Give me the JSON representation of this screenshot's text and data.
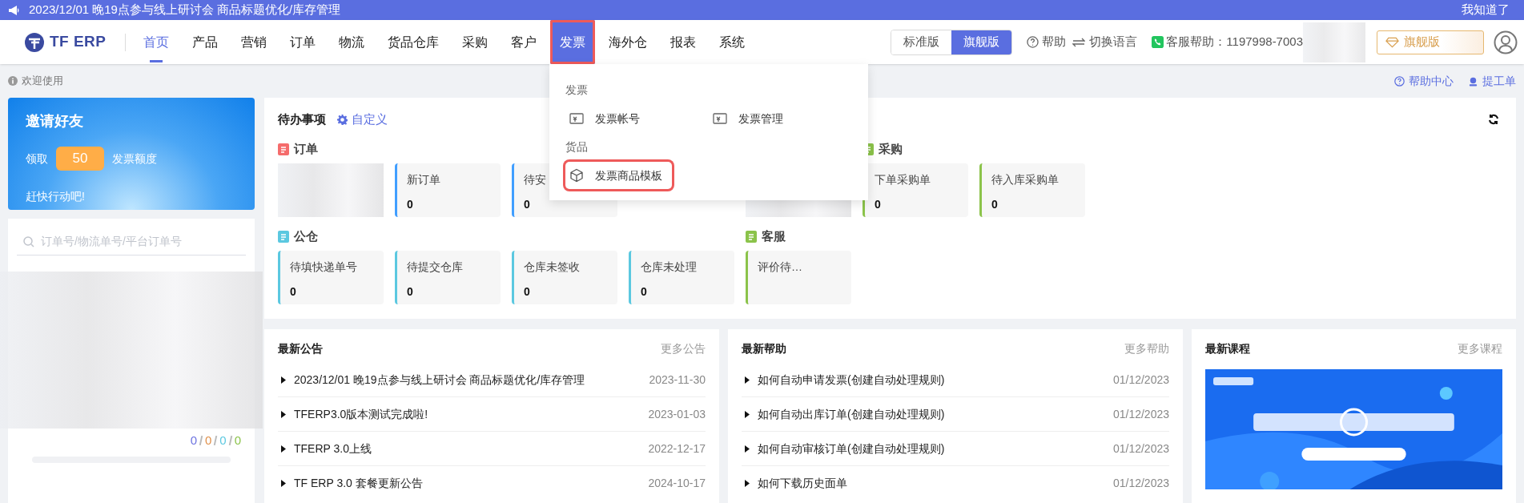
{
  "banner": {
    "text": "2023/12/01 晚19点参与线上研讨会 商品标题优化/库存管理",
    "dismiss": "我知道了"
  },
  "header": {
    "logo": "TF ERP",
    "nav": [
      {
        "label": "首页",
        "selected": true,
        "open": false,
        "annotated": false
      },
      {
        "label": "产品",
        "selected": false,
        "open": false,
        "annotated": false
      },
      {
        "label": "营销",
        "selected": false,
        "open": false,
        "annotated": false
      },
      {
        "label": "订单",
        "selected": false,
        "open": false,
        "annotated": false
      },
      {
        "label": "物流",
        "selected": false,
        "open": false,
        "annotated": false
      },
      {
        "label": "货品仓库",
        "selected": false,
        "open": false,
        "annotated": false
      },
      {
        "label": "采购",
        "selected": false,
        "open": false,
        "annotated": false
      },
      {
        "label": "客户",
        "selected": false,
        "open": false,
        "annotated": false
      },
      {
        "label": "发票",
        "selected": false,
        "open": true,
        "annotated": true
      },
      {
        "label": "海外仓",
        "selected": false,
        "open": false,
        "annotated": false
      },
      {
        "label": "报表",
        "selected": false,
        "open": false,
        "annotated": false
      },
      {
        "label": "系统",
        "selected": false,
        "open": false,
        "annotated": false
      }
    ],
    "editions": [
      {
        "label": "标准版",
        "selected": false
      },
      {
        "label": "旗舰版",
        "selected": true
      }
    ],
    "help": "帮助",
    "language": "切换语言",
    "support": "客服帮助：1197998-7003",
    "upgrade": "旗舰版"
  },
  "dropdown": {
    "groups": [
      {
        "title": "发票",
        "items": [
          {
            "label": "发票帐号",
            "kind": "invoice",
            "annotated": false
          },
          {
            "label": "发票管理",
            "kind": "invoice",
            "annotated": false
          }
        ]
      },
      {
        "title": "货品",
        "items": [
          {
            "label": "发票商品模板",
            "kind": "box",
            "annotated": true
          }
        ]
      }
    ]
  },
  "welcome": {
    "text": "欢迎使用",
    "links": [
      {
        "label": "帮助中心",
        "kind": "help"
      },
      {
        "label": "提工单",
        "kind": "ticket"
      }
    ]
  },
  "invite": {
    "title": "邀请好友",
    "prefix": "领取",
    "amount": "50",
    "suffix": "发票额度",
    "cta": "赶快行动吧!"
  },
  "sidebar": {
    "search": {
      "placeholder": "订单号/物流单号/平台订单号"
    },
    "counts": [
      {
        "value": "0",
        "color": "#6c72e0"
      },
      {
        "value": "0",
        "color": "#e0904a"
      },
      {
        "value": "0",
        "color": "#5bc8e0"
      },
      {
        "value": "0",
        "color": "#8bc34a"
      }
    ]
  },
  "todo": {
    "title": "待办事项",
    "customize": "自定义",
    "rows": [
      {
        "sections": [
          {
            "label": "订单",
            "color": "#f56c6c",
            "cards": [
              {
                "kind": "blurred"
              },
              {
                "kind": "card",
                "label": "新订单",
                "value": "0",
                "color": "#409eff"
              },
              {
                "kind": "card",
                "label": "待安",
                "value": "0",
                "color": "#409eff"
              },
              {
                "kind": "hidden"
              },
              {
                "kind": "blurred"
              }
            ]
          },
          {
            "label": "采购",
            "color": "#8bc34a",
            "cards": [
              {
                "kind": "card",
                "label": "下单采购单",
                "value": "0",
                "color": "#8bc34a"
              },
              {
                "kind": "card",
                "label": "待入库采购单",
                "value": "0",
                "color": "#8bc34a"
              }
            ]
          }
        ]
      },
      {
        "sections": [
          {
            "label": "公仓",
            "color": "#5bc8e0",
            "cards": [
              {
                "kind": "card",
                "label": "待填快递单号",
                "value": "0",
                "color": "#5bc8e0"
              },
              {
                "kind": "card",
                "label": "待提交仓库",
                "value": "0",
                "color": "#5bc8e0"
              },
              {
                "kind": "card",
                "label": "仓库未签收",
                "value": "0",
                "color": "#5bc8e0"
              },
              {
                "kind": "card",
                "label": "仓库未处理",
                "value": "0",
                "color": "#5bc8e0"
              }
            ]
          },
          {
            "label": "客服",
            "color": "#8bc34a",
            "cards": [
              {
                "kind": "card",
                "label": "评价待…",
                "color": "#8bc34a"
              }
            ]
          }
        ]
      }
    ]
  },
  "panels": [
    {
      "title": "最新公告",
      "more": "更多公告",
      "kind": "list",
      "items": [
        {
          "text": "2023/12/01 晚19点参与线上研讨会 商品标题优化/库存管理",
          "date": "2023-11-30"
        },
        {
          "text": "TFERP3.0版本测试完成啦!",
          "date": "2023-01-03"
        },
        {
          "text": "TFERP 3.0上线",
          "date": "2022-12-17"
        },
        {
          "text": "TF ERP 3.0 套餐更新公告",
          "date": "2024-10-17"
        }
      ]
    },
    {
      "title": "最新帮助",
      "more": "更多帮助",
      "kind": "list",
      "items": [
        {
          "text": "如何自动申请发票(创建自动处理规则)",
          "date": "01/12/2023"
        },
        {
          "text": "如何自动出库订单(创建自动处理规则)",
          "date": "01/12/2023"
        },
        {
          "text": "如何自动审核订单(创建自动处理规则)",
          "date": "01/12/2023"
        },
        {
          "text": "如何下载历史面单",
          "date": "01/12/2023"
        }
      ]
    },
    {
      "title": "最新课程",
      "more": "更多课程",
      "kind": "course"
    }
  ]
}
